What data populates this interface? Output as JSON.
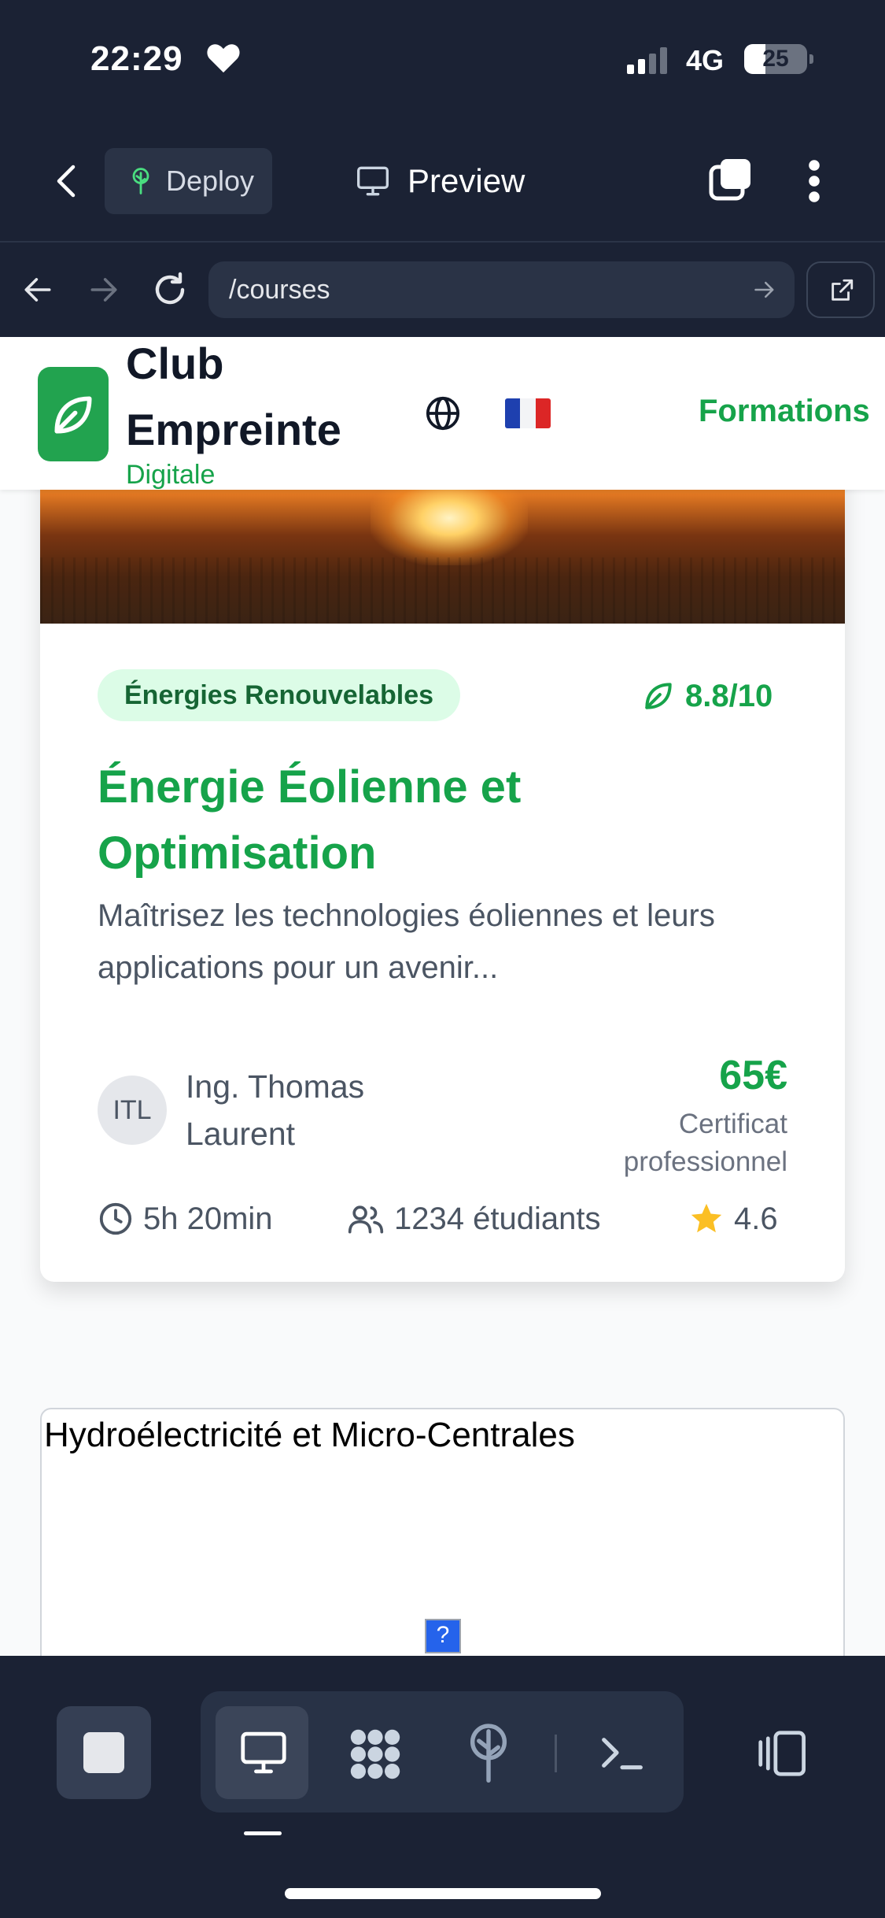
{
  "status_bar": {
    "time": "22:29",
    "network": "4G",
    "battery": "25"
  },
  "toolbar": {
    "deploy_label": "Deploy",
    "preview_label": "Preview"
  },
  "browser": {
    "url": "/courses"
  },
  "site_header": {
    "brand_line1": "Club",
    "brand_line2": "Empreinte",
    "brand_line3": "Digitale",
    "nav_link": "Formations"
  },
  "course_card": {
    "category": "Énergies Renouvelables",
    "eco_score": "8.8/10",
    "title": "Énergie Éolienne et Optimisation",
    "description": "Maîtrisez les technologies éoliennes et leurs applications pour un avenir...",
    "instructor_initials": "ITL",
    "instructor_name": "Ing. Thomas Laurent",
    "price": "65€",
    "certificate": "Certificat professionnel",
    "duration": "5h 20min",
    "students": "1234 étudiants",
    "rating": "4.6"
  },
  "next_card": {
    "title": "Hydroélectricité et Micro-Centrales",
    "broken_image": "?"
  },
  "colors": {
    "brand_green": "#16a34a",
    "dark_bg": "#1b2234",
    "star": "#fbbf24"
  },
  "icons": [
    "back-icon",
    "tree-icon",
    "monitor-icon",
    "tabs-icon",
    "more-icon",
    "arrow-left-icon",
    "arrow-right-icon",
    "reload-icon",
    "go-icon",
    "external-link-icon",
    "leaf-icon",
    "globe-icon",
    "clock-icon",
    "users-icon",
    "star-icon",
    "stop-icon",
    "desktop-icon",
    "apps-icon",
    "deploy-icon",
    "terminal-icon",
    "device-icon"
  ]
}
